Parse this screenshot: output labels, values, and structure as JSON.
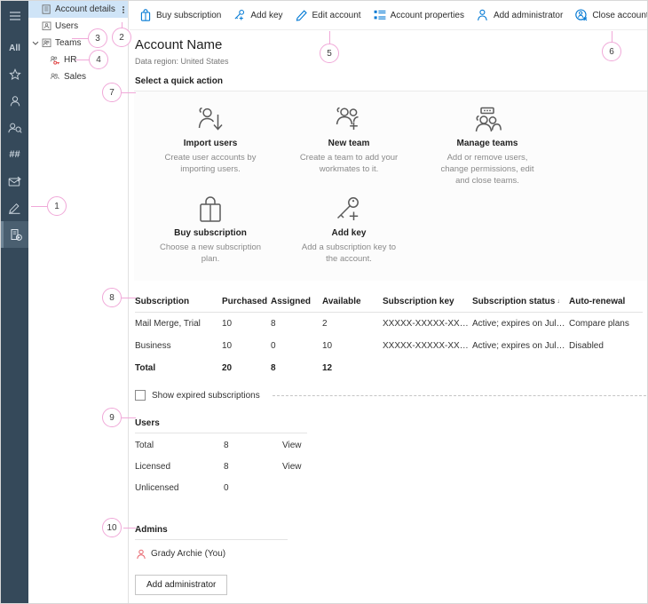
{
  "rail": {
    "items": [
      {
        "name": "hamburger-menu",
        "glyph": "menu"
      },
      {
        "name": "all-filter",
        "label": "All"
      },
      {
        "name": "favorites",
        "glyph": "star"
      },
      {
        "name": "users",
        "glyph": "person"
      },
      {
        "name": "contacts",
        "glyph": "person-search"
      },
      {
        "name": "numbers",
        "label": "##"
      },
      {
        "name": "mail",
        "glyph": "mail"
      },
      {
        "name": "signature",
        "glyph": "pen"
      },
      {
        "name": "account",
        "glyph": "account",
        "selected": true
      }
    ]
  },
  "tree": {
    "items": [
      {
        "label": "Account details",
        "icon": "account-details-icon",
        "selected": true,
        "level": 0,
        "kebab": true
      },
      {
        "label": "Users",
        "icon": "users-icon",
        "selected": false,
        "level": 0
      },
      {
        "label": "Teams",
        "icon": "teams-icon",
        "selected": false,
        "level": 0,
        "chevron": "⌄"
      },
      {
        "label": "HR",
        "icon": "team-key-icon",
        "selected": false,
        "level": 1
      },
      {
        "label": "Sales",
        "icon": "team-icon",
        "selected": false,
        "level": 1
      }
    ]
  },
  "commandbar": {
    "buttons": [
      {
        "label": "Buy subscription",
        "icon": "shopping-bag-icon"
      },
      {
        "label": "Add key",
        "icon": "key-plus-icon"
      },
      {
        "label": "Edit account",
        "icon": "pencil-icon"
      },
      {
        "label": "Account properties",
        "icon": "list-properties-icon"
      },
      {
        "label": "Add administrator",
        "icon": "person-admin-icon"
      },
      {
        "label": "Close account",
        "icon": "person-close-icon"
      }
    ]
  },
  "header": {
    "title": "Account Name",
    "region": "Data region: United States"
  },
  "quick_actions": {
    "heading": "Select a quick action",
    "cards": [
      {
        "title": "Import users",
        "icon": "import-users-icon",
        "desc": "Create user accounts by importing users."
      },
      {
        "title": "New team",
        "icon": "new-team-icon",
        "desc": "Create a team to add your workmates to it."
      },
      {
        "title": "Manage teams",
        "icon": "manage-teams-icon",
        "desc": "Add or remove users, change permissions, edit and close teams."
      },
      {
        "title": "Buy subscription",
        "icon": "shopping-bag-icon",
        "desc": "Choose a new subscription plan."
      },
      {
        "title": "Add key",
        "icon": "key-plus-icon",
        "desc": "Add a subscription key to the account."
      }
    ]
  },
  "subscriptions": {
    "columns": [
      "Subscription",
      "Purchased",
      "Assigned",
      "Available",
      "Subscription key",
      "Subscription status",
      "Auto-renewal"
    ],
    "sorted_column": "Subscription status",
    "sort_mark": "↓",
    "rows": [
      {
        "subscription": "Mail Merge, Trial",
        "purchased": "10",
        "assigned": "8",
        "available": "2",
        "key": "XXXXX-XXXXX-XX…",
        "status": "Active; expires on Jul…",
        "renewal": "Compare plans",
        "renewal_is_link": true
      },
      {
        "subscription": "Business",
        "purchased": "10",
        "assigned": "0",
        "available": "10",
        "key": "XXXXX-XXXXX-XX…",
        "status": "Active; expires on Jul…",
        "renewal": "Disabled",
        "renewal_is_link": false
      }
    ],
    "total": {
      "subscription": "Total",
      "purchased": "20",
      "assigned": "8",
      "available": "12",
      "key": "",
      "status": "",
      "renewal": ""
    },
    "show_expired_label": "Show expired subscriptions",
    "show_expired_checked": false
  },
  "users": {
    "heading": "Users",
    "rows": [
      {
        "label": "Total",
        "value": "8",
        "action": "View",
        "muted": false
      },
      {
        "label": "Licensed",
        "value": "8",
        "action": "View",
        "muted": false
      },
      {
        "label": "Unlicensed",
        "value": "0",
        "action": "",
        "muted": true
      }
    ]
  },
  "admins": {
    "heading": "Admins",
    "person": "Grady Archie (You)",
    "person_icon": "person-icon",
    "add_button": "Add administrator"
  },
  "callouts": [
    {
      "n": "1"
    },
    {
      "n": "2"
    },
    {
      "n": "3"
    },
    {
      "n": "4"
    },
    {
      "n": "5"
    },
    {
      "n": "6"
    },
    {
      "n": "7"
    },
    {
      "n": "8"
    },
    {
      "n": "9"
    },
    {
      "n": "10"
    }
  ],
  "colors": {
    "rail_bg": "#35495a",
    "rail_selected": "#4a5f70",
    "tree_selected": "#cfe4f7",
    "accent_icon": "#0078d4",
    "link": "#2f7fd1",
    "warn_red": "#e8656d",
    "callout_pink": "#f0a8d8"
  }
}
